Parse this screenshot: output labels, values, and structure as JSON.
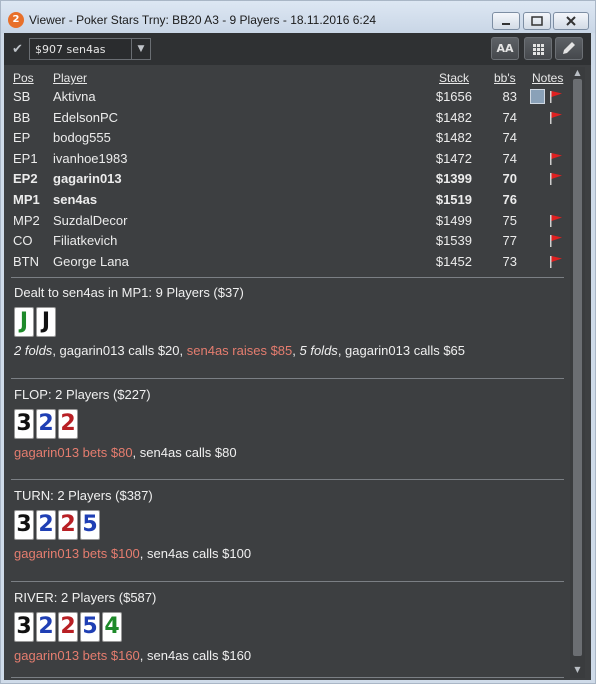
{
  "window": {
    "title": "Viewer - Poker Stars Trny: BB20 A3 - 9 Players - 18.11.2016 6:24",
    "app_badge": "2"
  },
  "toolbar": {
    "player_select": "$907 sen4as",
    "font_button": "AA"
  },
  "table": {
    "headers": {
      "pos": "Pos",
      "player": "Player",
      "stack": "Stack",
      "bbs": "bb's",
      "notes": "Notes"
    },
    "rows": [
      {
        "pos": "SB",
        "player": "Aktivna",
        "stack": "$1656",
        "bbs": "83",
        "avatar": true,
        "flag": true,
        "bold": false
      },
      {
        "pos": "BB",
        "player": "EdelsonPC",
        "stack": "$1482",
        "bbs": "74",
        "avatar": false,
        "flag": true,
        "bold": false
      },
      {
        "pos": "EP",
        "player": "bodog555",
        "stack": "$1482",
        "bbs": "74",
        "avatar": false,
        "flag": false,
        "bold": false
      },
      {
        "pos": "EP1",
        "player": "ivanhoe1983",
        "stack": "$1472",
        "bbs": "74",
        "avatar": false,
        "flag": true,
        "bold": false
      },
      {
        "pos": "EP2",
        "player": "gagarin013",
        "stack": "$1399",
        "bbs": "70",
        "avatar": false,
        "flag": true,
        "bold": true
      },
      {
        "pos": "MP1",
        "player": "sen4as",
        "stack": "$1519",
        "bbs": "76",
        "avatar": false,
        "flag": false,
        "bold": true
      },
      {
        "pos": "MP2",
        "player": "SuzdalDecor",
        "stack": "$1499",
        "bbs": "75",
        "avatar": false,
        "flag": true,
        "bold": false
      },
      {
        "pos": "CO",
        "player": "Filiatkevich",
        "stack": "$1539",
        "bbs": "77",
        "avatar": false,
        "flag": true,
        "bold": false
      },
      {
        "pos": "BTN",
        "player": "George Lana",
        "stack": "$1452",
        "bbs": "73",
        "avatar": false,
        "flag": true,
        "bold": false
      }
    ]
  },
  "colors": {
    "red_action": "#e57d6f",
    "flag": "#e02020",
    "card_black": "#111111",
    "card_blue": "#1f3fb4",
    "card_red": "#b81f24",
    "card_green": "#1e8a2a"
  },
  "sections": [
    {
      "title": "Dealt to sen4as in MP1: 9 Players ($37)",
      "cards": [
        {
          "rank": "J",
          "color": "green"
        },
        {
          "rank": "J",
          "color": "black"
        }
      ],
      "actions": [
        {
          "text": "2 folds",
          "style": "italic"
        },
        {
          "text": ", gagarin013 calls $20, ",
          "style": "normal"
        },
        {
          "text": "sen4as raises $85",
          "style": "red"
        },
        {
          "text": ", ",
          "style": "normal"
        },
        {
          "text": "5 folds",
          "style": "italic"
        },
        {
          "text": ", gagarin013 calls $65",
          "style": "normal"
        }
      ]
    },
    {
      "title": "FLOP: 2 Players ($227)",
      "cards": [
        {
          "rank": "3",
          "color": "black"
        },
        {
          "rank": "2",
          "color": "blue"
        },
        {
          "rank": "2",
          "color": "red"
        }
      ],
      "actions": [
        {
          "text": "gagarin013 bets $80",
          "style": "red"
        },
        {
          "text": ", sen4as calls $80",
          "style": "normal"
        }
      ]
    },
    {
      "title": "TURN: 2 Players ($387)",
      "cards": [
        {
          "rank": "3",
          "color": "black"
        },
        {
          "rank": "2",
          "color": "blue"
        },
        {
          "rank": "2",
          "color": "red"
        },
        {
          "rank": "5",
          "color": "blue"
        }
      ],
      "actions": [
        {
          "text": "gagarin013 bets $100",
          "style": "red"
        },
        {
          "text": ", sen4as calls $100",
          "style": "normal"
        }
      ]
    },
    {
      "title": "RIVER: 2 Players ($587)",
      "cards": [
        {
          "rank": "3",
          "color": "black"
        },
        {
          "rank": "2",
          "color": "blue"
        },
        {
          "rank": "2",
          "color": "red"
        },
        {
          "rank": "5",
          "color": "blue"
        },
        {
          "rank": "4",
          "color": "green"
        }
      ],
      "actions": [
        {
          "text": "gagarin013 bets $160",
          "style": "red"
        },
        {
          "text": ", sen4as calls $160",
          "style": "normal"
        }
      ]
    }
  ]
}
